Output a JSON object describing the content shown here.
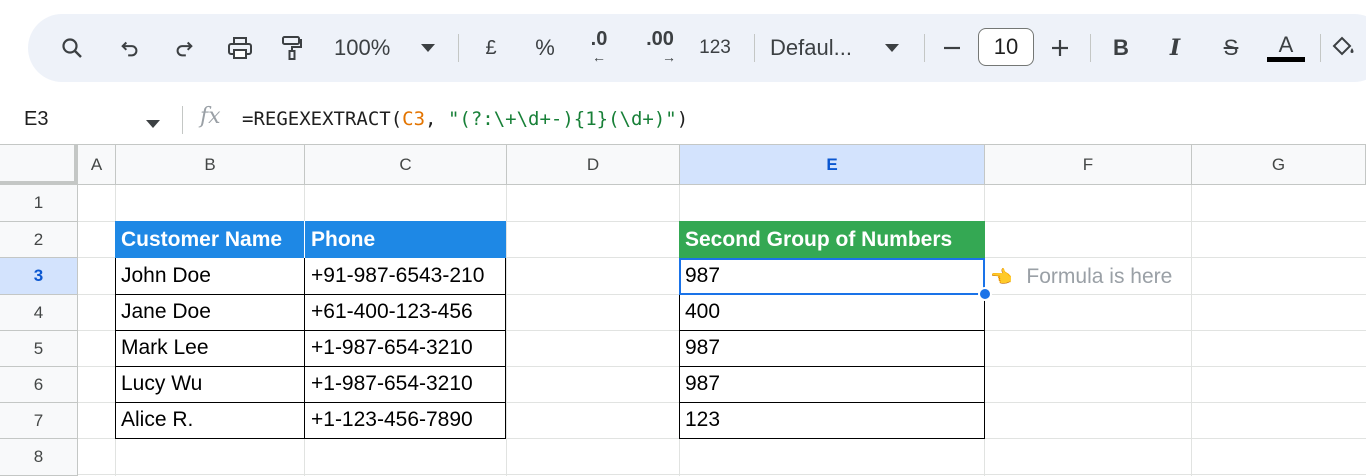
{
  "toolbar": {
    "zoom": "100%",
    "currency": "£",
    "percent": "%",
    "decrease_decimals": ".0",
    "increase_decimals": ".00",
    "number_format": "123",
    "font_family": "Defaul...",
    "font_size": "10",
    "bold": "B",
    "italic": "I",
    "strikethrough": "S",
    "text_color": "A",
    "icons": [
      "search-icon",
      "undo-icon",
      "redo-icon",
      "print-icon",
      "paint-format-icon",
      "chevron-down-icon",
      "minus-icon",
      "plus-icon",
      "fill-color-icon"
    ]
  },
  "formula_bar": {
    "name_box": "E3",
    "fx": "fx",
    "formula_prefix": "=REGEXEXTRACT(",
    "formula_ref": "C3",
    "formula_sep": ", ",
    "formula_string": "\"(?:\\+\\d+-){1}(\\d+)\"",
    "formula_suffix": ")"
  },
  "columns": [
    "A",
    "B",
    "C",
    "D",
    "E",
    "F",
    "G"
  ],
  "rows": [
    "1",
    "2",
    "3",
    "4",
    "5",
    "6",
    "7",
    "8"
  ],
  "selected": {
    "column": "E",
    "row": "3"
  },
  "table1": {
    "headers": [
      "Customer Name",
      "Phone"
    ],
    "rows": [
      [
        "John Doe",
        "+91-987-6543-210"
      ],
      [
        "Jane Doe",
        "+61-400-123-456"
      ],
      [
        "Mark Lee",
        "+1-987-654-3210"
      ],
      [
        "Lucy Wu",
        "+1-987-654-3210"
      ],
      [
        "Alice R.",
        "+1-123-456-7890"
      ]
    ]
  },
  "table2": {
    "header": "Second Group of Numbers",
    "values": [
      "987",
      "400",
      "987",
      "987",
      "123"
    ]
  },
  "note": {
    "hand": "👈",
    "text": "Formula is here"
  },
  "colors": {
    "header_blue": "#1e88e5",
    "header_green": "#34a853",
    "selection": "#1a73e8"
  }
}
